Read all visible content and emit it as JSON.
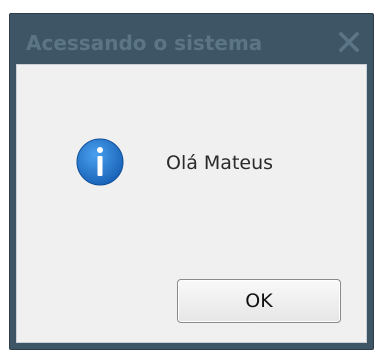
{
  "dialog": {
    "title": "Acessando o sistema",
    "message": "Olá Mateus",
    "icon": "info-icon",
    "ok_label": "OK",
    "close_icon": "close-icon"
  },
  "colors": {
    "frame": "#3e5565",
    "title_text": "#5c7586",
    "content_bg": "#f0f0f0",
    "icon_blue": "#1f73c9"
  }
}
